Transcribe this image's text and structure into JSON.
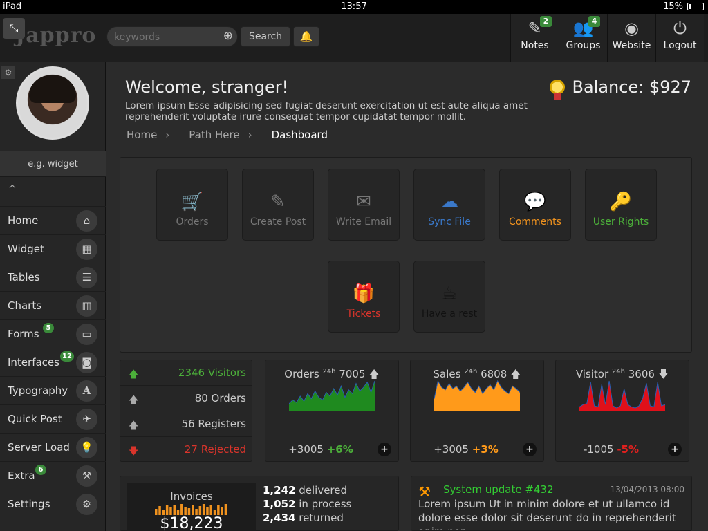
{
  "statusbar": {
    "device": "iPad",
    "time": "13:57",
    "battery": "15%"
  },
  "header": {
    "logo": "Jappro",
    "search_placeholder": "keywords",
    "search_label": "Search",
    "nav": [
      {
        "label": "Notes",
        "badge": "2",
        "icon": "edit-icon"
      },
      {
        "label": "Groups",
        "badge": "4",
        "icon": "users-icon"
      },
      {
        "label": "Website",
        "badge": "",
        "icon": "eye-icon"
      },
      {
        "label": "Logout",
        "badge": "",
        "icon": "power-icon"
      }
    ]
  },
  "sidebar": {
    "widget_label": "e.g. widget",
    "items": [
      {
        "label": "Home",
        "badge": "",
        "icon": "home-icon"
      },
      {
        "label": "Widget",
        "badge": "",
        "icon": "grid-icon"
      },
      {
        "label": "Tables",
        "badge": "",
        "icon": "table-icon"
      },
      {
        "label": "Charts",
        "badge": "",
        "icon": "bar-chart-icon"
      },
      {
        "label": "Forms",
        "badge": "5",
        "icon": "credit-card-icon"
      },
      {
        "label": "Interfaces",
        "badge": "12",
        "icon": "camera-icon"
      },
      {
        "label": "Typography",
        "badge": "",
        "icon": "font-icon"
      },
      {
        "label": "Quick Post",
        "badge": "",
        "icon": "plane-icon"
      },
      {
        "label": "Server Load",
        "badge": "",
        "icon": "lightbulb-icon"
      },
      {
        "label": "Extra",
        "badge": "6",
        "icon": "hammer-icon"
      },
      {
        "label": "Settings",
        "badge": "",
        "icon": "gear-icon"
      }
    ]
  },
  "main": {
    "welcome": "Welcome, stranger!",
    "intro": "Lorem ipsum Esse adipisicing sed fugiat deserunt exercitation ut est aute aliqua amet reprehenderit voluptate irure consequat tempor cupidatat tempor mollit.",
    "balance": "Balance: $927",
    "breadcrumb": [
      "Home",
      "Path Here",
      "Dashboard"
    ]
  },
  "shortcuts": [
    {
      "label": "Orders",
      "icon": "cart-icon",
      "color": "#777777"
    },
    {
      "label": "Create Post",
      "icon": "edit-icon",
      "color": "#777777"
    },
    {
      "label": "Write Email",
      "icon": "envelope-icon",
      "color": "#777777"
    },
    {
      "label": "Sync File",
      "icon": "cloud-upload-icon",
      "color": "#3a78c9"
    },
    {
      "label": "Comments",
      "icon": "comments-icon",
      "color": "#f0921e"
    },
    {
      "label": "User Rights",
      "icon": "key-icon",
      "color": "#4caf3a"
    },
    {
      "label": "Tickets",
      "icon": "gift-icon",
      "color": "#d9342b"
    },
    {
      "label": "Have a rest",
      "icon": "coffee-icon",
      "color": "#111111"
    }
  ],
  "stats": [
    {
      "value": "2346 Visitors",
      "direction": "up",
      "color": "#4caf3a",
      "arrow_color": "#4caf3a"
    },
    {
      "value": "80 Orders",
      "direction": "up",
      "color": "#cccccc",
      "arrow_color": "#aaaaaa"
    },
    {
      "value": "56 Registers",
      "direction": "up",
      "color": "#cccccc",
      "arrow_color": "#aaaaaa"
    },
    {
      "value": "27 Rejected",
      "direction": "down",
      "color": "#d9342b",
      "arrow_color": "#d9342b"
    }
  ],
  "sparks": [
    {
      "title": "Orders",
      "period": "24h",
      "value": "7005",
      "arrow": "up",
      "foot_value": "+3005",
      "foot_pct": "+6%",
      "pct_color": "#4caf3a",
      "fill": "#1f8a1f",
      "stroke": "#2a5db0",
      "series": [
        6,
        9,
        7,
        12,
        8,
        14,
        10,
        16,
        11,
        9,
        15,
        12,
        18,
        13,
        20,
        11,
        17,
        14,
        22,
        16,
        19,
        23,
        15,
        24
      ]
    },
    {
      "title": "Sales",
      "period": "24h",
      "value": "6808",
      "arrow": "up",
      "foot_value": "+3005",
      "foot_pct": "+3%",
      "pct_color": "#ff9a1a",
      "fill": "#ff9a1a",
      "stroke": "#2a5db0",
      "series": [
        10,
        24,
        19,
        17,
        22,
        18,
        20,
        16,
        19,
        23,
        18,
        15,
        20,
        14,
        18,
        21,
        17,
        24,
        19,
        16,
        14,
        20,
        18,
        15
      ]
    },
    {
      "title": "Visitor",
      "period": "24h",
      "value": "3606",
      "arrow": "down",
      "foot_value": "-1005",
      "foot_pct": "-5%",
      "pct_color": "#e0201e",
      "fill": "#e0101a",
      "stroke": "#2a5db0",
      "series": [
        4,
        6,
        7,
        26,
        5,
        4,
        24,
        6,
        27,
        5,
        3,
        5,
        20,
        6,
        4,
        3,
        5,
        12,
        25,
        5,
        4,
        26,
        5,
        6
      ]
    }
  ],
  "invoices": {
    "title": "Invoices",
    "total": "$18,223",
    "bars": [
      9,
      13,
      7,
      15,
      11,
      14,
      8,
      16,
      12,
      10,
      15,
      9,
      13,
      16,
      11,
      14,
      8,
      15,
      12,
      16
    ],
    "bar_color": "#f0921e",
    "delivered_num": "1,242",
    "delivered_lbl": "delivered",
    "process_num": "1,052",
    "process_lbl": "in process",
    "returned_num": "2,434",
    "returned_lbl": "returned"
  },
  "news": {
    "title": "System update #432",
    "date": "13/04/2013 08:00",
    "body": "Lorem ipsum Ut in minim dolore et ut ullamco id dolore esse dolor sit deserunt do in reprehenderit anim non"
  }
}
